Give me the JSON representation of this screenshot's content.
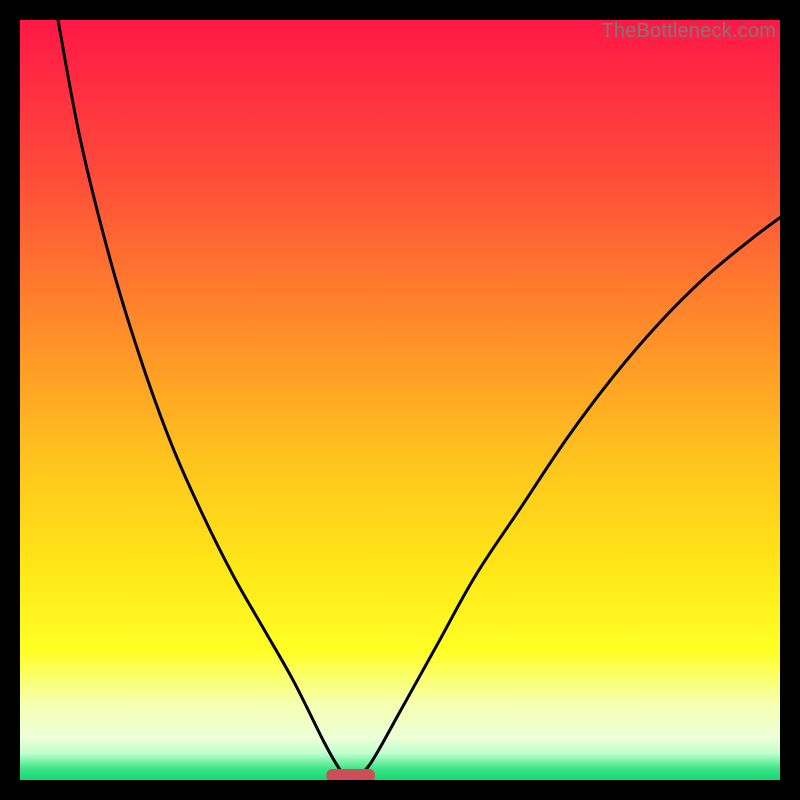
{
  "watermark": "TheBottleneck.com",
  "chart_data": {
    "type": "line",
    "title": "",
    "xlabel": "",
    "ylabel": "",
    "xlim": [
      0,
      100
    ],
    "ylim": [
      0,
      100
    ],
    "grid": false,
    "legend": false,
    "gradient_stops": [
      {
        "offset": 0.0,
        "color": "#ff1846"
      },
      {
        "offset": 0.2,
        "color": "#ff4a3a"
      },
      {
        "offset": 0.4,
        "color": "#ff8a2a"
      },
      {
        "offset": 0.58,
        "color": "#ffc41e"
      },
      {
        "offset": 0.72,
        "color": "#ffe617"
      },
      {
        "offset": 0.83,
        "color": "#ffff25"
      },
      {
        "offset": 0.9,
        "color": "#f6ffb0"
      },
      {
        "offset": 0.945,
        "color": "#ecffd8"
      },
      {
        "offset": 0.965,
        "color": "#bfffcf"
      },
      {
        "offset": 0.985,
        "color": "#3fe587"
      },
      {
        "offset": 1.0,
        "color": "#14d877"
      }
    ],
    "optimal_marker": {
      "x_center": 43.5,
      "x_halfwidth": 3.2,
      "y": 0.6,
      "color": "#cc4e57"
    },
    "series": [
      {
        "name": "left-branch",
        "x": [
          5,
          8,
          12,
          16,
          20,
          24,
          28,
          32,
          36,
          40,
          42,
          43
        ],
        "y": [
          100,
          84,
          68,
          55,
          44,
          35,
          27,
          20,
          13,
          5,
          1.5,
          0.5
        ]
      },
      {
        "name": "right-branch",
        "x": [
          44,
          46,
          50,
          55,
          60,
          66,
          72,
          78,
          84,
          90,
          96,
          100
        ],
        "y": [
          0.5,
          2,
          9,
          18,
          27,
          36,
          45,
          53,
          60,
          66,
          71,
          74
        ]
      }
    ]
  }
}
